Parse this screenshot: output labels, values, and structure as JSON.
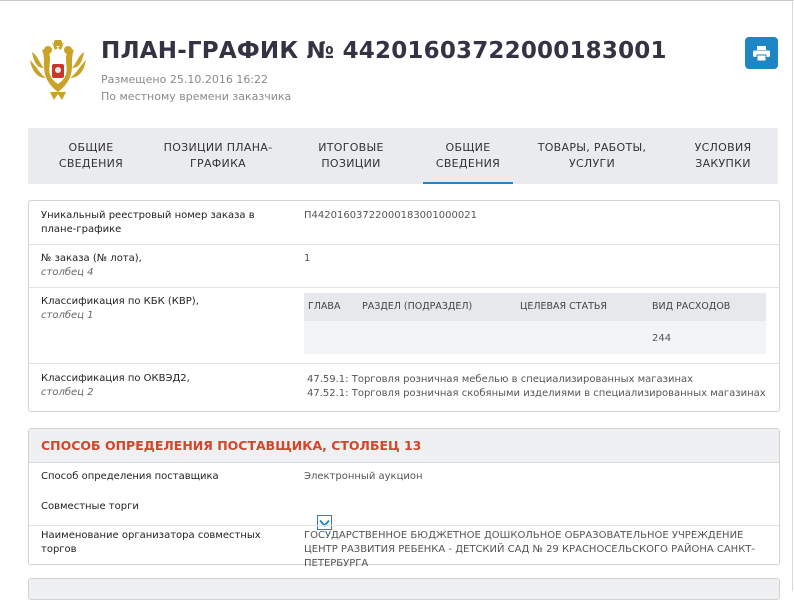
{
  "header": {
    "title": "ПЛАН-ГРАФИК № 442016037220001830​01",
    "posted": "Размещено 25.10.2016 16:22",
    "timezone_note": "По местному времени заказчика",
    "print_icon": "printer-icon",
    "emblem_icon": "coat-of-arms-icon"
  },
  "tabs": [
    {
      "label": "ОБЩИЕ\nСВЕДЕНИЯ",
      "active": false
    },
    {
      "label": "ПОЗИЦИИ ПЛАНА-\nГРАФИКА",
      "active": false
    },
    {
      "label": "ИТОГОВЫЕ\nПОЗИЦИИ",
      "active": false
    },
    {
      "label": "ОБЩИЕ\nСВЕДЕНИЯ",
      "active": true
    },
    {
      "label": "ТОВАРЫ, РАБОТЫ,\nУСЛУГИ",
      "active": false
    },
    {
      "label": "УСЛОВИЯ\nЗАКУПКИ",
      "active": false
    }
  ],
  "info": {
    "reg_label": "Уникальный реестровый номер заказа в плане-графике",
    "reg_value": "П442016037220001830010000​21",
    "order_label": "№ заказа (№ лота),",
    "order_col": "столбец 4",
    "order_value": "1",
    "kbk_label": "Классификация по КБК (КВР),",
    "kbk_col": "столбец 1",
    "kbk_headers": [
      "ГЛАВА",
      "РАЗДЕЛ (ПОДРАЗДЕЛ)",
      "ЦЕЛЕВАЯ СТАТЬЯ",
      "ВИД РАСХОДОВ"
    ],
    "kbk_values": [
      "",
      "",
      "",
      "244"
    ],
    "okved_label": "Классификация по ОКВЭД2,",
    "okved_col": "столбец 2",
    "okved_lines": [
      "47.59.1: Торговля розничная мебелью в специализированных магазинах",
      "47.52.1: Торговля розничная скобяными изделиями в специализированных магазинах"
    ]
  },
  "supplier": {
    "section_title": "СПОСОБ ОПРЕДЕЛЕНИЯ ПОСТАВЩИКА, СТОЛБЕЦ 13",
    "method_label": "Способ определения поставщика",
    "method_value": "Электронный аукцион",
    "joint_label": "Совместные торги",
    "joint_checked": true,
    "organizer_label": "Наименование организатора совместных торгов",
    "organizer_value": "ГОСУДАРСТВЕННОЕ БЮДЖЕТНОЕ ДОШКОЛЬНОЕ ОБРАЗОВАТЕЛЬНОЕ УЧРЕЖДЕНИЕ ЦЕНТР РАЗВИТИЯ РЕБЕНКА - ДЕТСКИЙ САД № 29 КРАСНОСЕЛЬСКОГО РАЙОНА САНКТ-ПЕТЕРБУРГА"
  },
  "colors": {
    "accent": "#1f86c6",
    "section_title": "#d4452a",
    "tab_bg": "#e9ebee"
  }
}
